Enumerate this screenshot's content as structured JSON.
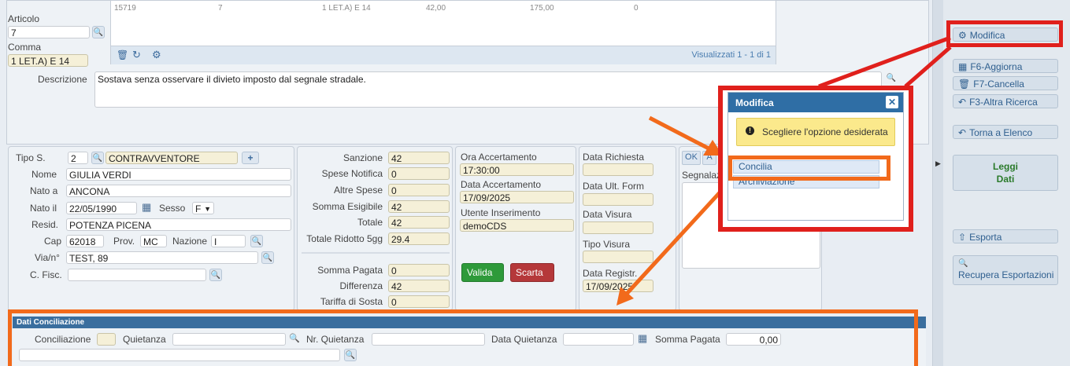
{
  "top_row": {
    "cells": [
      "15719",
      "7",
      "1 LET.A) E 14",
      "42,00",
      "175,00",
      "0"
    ]
  },
  "articolo": {
    "label": "Articolo",
    "value": "7"
  },
  "comma": {
    "label": "Comma",
    "value": "1 LET.A) E 14"
  },
  "grid_footer": {
    "count": "Visualizzati 1 - 1 di 1"
  },
  "descrizione": {
    "label": "Descrizione",
    "value": "Sostava senza osservare il divieto imposto dal segnale stradale."
  },
  "person": {
    "tipo_label": "Tipo S.",
    "tipo_code": "2",
    "tipo_desc": "CONTRAVVENTORE",
    "nome_label": "Nome",
    "nome": "GIULIA VERDI",
    "nato_a_label": "Nato a",
    "nato_a": "ANCONA",
    "nato_il_label": "Nato il",
    "nato_il": "22/05/1990",
    "sesso_label": "Sesso",
    "sesso": "F",
    "resid_label": "Resid.",
    "resid": "POTENZA PICENA",
    "cap_label": "Cap",
    "cap": "62018",
    "prov_label": "Prov.",
    "prov": "MC",
    "nazione_label": "Nazione",
    "nazione": "I",
    "via_label": "Via/n°",
    "via": "TEST, 89",
    "cf_label": "C. Fisc.",
    "cf": ""
  },
  "amounts": {
    "sanzione_label": "Sanzione",
    "sanzione": "42",
    "spese_label": "Spese Notifica",
    "spese": "0",
    "altre_label": "Altre Spese",
    "altre": "0",
    "somma_es_label": "Somma Esigibile",
    "somma_es": "42",
    "totale_label": "Totale",
    "totale": "42",
    "ridotto_label": "Totale Ridotto 5gg",
    "ridotto": "29.4",
    "pagata_label": "Somma Pagata",
    "pagata": "0",
    "diff_label": "Differenza",
    "diff": "42",
    "tariffa_label": "Tariffa di Sosta",
    "tariffa": "0"
  },
  "accert": {
    "ora_label": "Ora Accertamento",
    "ora": "17:30:00",
    "data_label": "Data Accertamento",
    "data": "17/09/2025",
    "utente_label": "Utente Inserimento",
    "utente": "demoCDS",
    "valida": "Valida",
    "scarta": "Scarta"
  },
  "dates": {
    "richiesta_label": "Data Richiesta",
    "richiesta": "",
    "ult_form_label": "Data Ult. Form",
    "ult_form": "",
    "visura_label": "Data Visura",
    "visura": "",
    "tipo_visura_label": "Tipo Visura",
    "tipo_visura": "",
    "registr_label": "Data Registr.",
    "registr": "17/09/2025"
  },
  "segnalazioni": {
    "ok": "OK",
    "a": "A",
    "label": "Segnalazi"
  },
  "conciliazione": {
    "header": "Dati Conciliazione",
    "conc_label": "Conciliazione",
    "conc": "",
    "quiet_label": "Quietanza",
    "quiet": "",
    "nr_label": "Nr. Quietanza",
    "nr": "",
    "data_label": "Data Quietanza",
    "data": "",
    "somma_label": "Somma Pagata",
    "somma": "0,00"
  },
  "sidebar": {
    "modifica": "Modifica",
    "aggiorna": "F6-Aggiorna",
    "cancella": "F7-Cancella",
    "altra": "F3-Altra Ricerca",
    "torna": "Torna a Elenco",
    "leggi_1": "Leggi",
    "leggi_2": "Dati",
    "esporta": "Esporta",
    "recupera": "Recupera Esportazioni"
  },
  "dialog": {
    "title": "Modifica",
    "message": "Scegliere l'opzione desiderata",
    "options": [
      "Concilia",
      "Archiviazione"
    ]
  },
  "colors": {
    "highlight_red": "#e0201c",
    "highlight_orange": "#f26a1b",
    "accent": "#2f6ea5"
  }
}
